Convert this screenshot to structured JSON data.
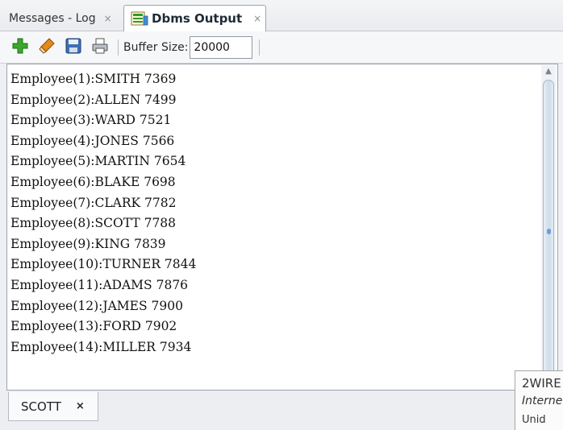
{
  "tabs": [
    {
      "label": "Messages - Log",
      "close": "×"
    },
    {
      "label": "Dbms Output",
      "close": "×"
    }
  ],
  "toolbar": {
    "buttons": [
      {
        "name": "enable-output",
        "icon": "plus-icon"
      },
      {
        "name": "clear-output",
        "icon": "eraser-icon"
      },
      {
        "name": "save-output",
        "icon": "save-icon"
      },
      {
        "name": "print-output",
        "icon": "print-icon"
      }
    ],
    "buffer_label": "Buffer Size:",
    "buffer_value": "20000"
  },
  "output": {
    "lines": [
      "Employee(1):SMITH 7369",
      "Employee(2):ALLEN 7499",
      "Employee(3):WARD 7521",
      "Employee(4):JONES 7566",
      "Employee(5):MARTIN 7654",
      "Employee(6):BLAKE 7698",
      "Employee(7):CLARK 7782",
      "Employee(8):SCOTT 7788",
      "Employee(9):KING 7839",
      "Employee(10):TURNER 7844",
      "Employee(11):ADAMS 7876",
      "Employee(12):JAMES 7900",
      "Employee(13):FORD 7902",
      "Employee(14):MILLER 7934"
    ]
  },
  "connection_tab": {
    "label": "SCOTT",
    "close": "×"
  },
  "tooltip": {
    "title": "2WIRE",
    "subtitle": "Interne",
    "more": "Unid"
  },
  "colors": {
    "plus_green": "#3aa82a",
    "eraser_orange": "#e28a1c",
    "save_blue": "#3c6fb3",
    "scroll_grip": "#6e9fd6"
  }
}
